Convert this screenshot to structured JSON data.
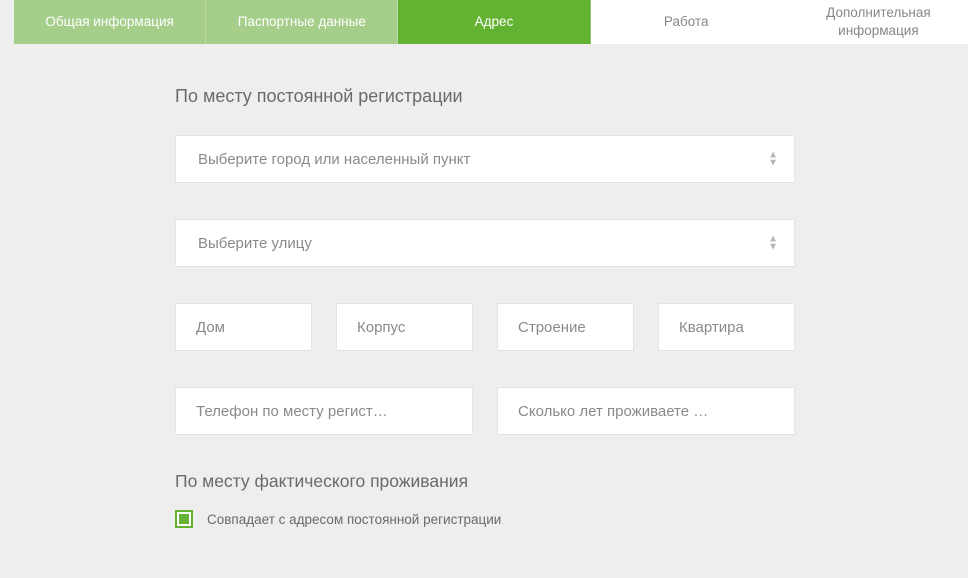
{
  "tabs": {
    "general": "Общая информация",
    "passport": "Паспортные данные",
    "address": "Адрес",
    "work": "Работа",
    "additional": "Дополнительная информация"
  },
  "section1_title": "По месту постоянной регистрации",
  "city_select": {
    "placeholder": "Выберите город или населенный пункт"
  },
  "street_select": {
    "placeholder": "Выберите улицу"
  },
  "house": {
    "placeholder": "Дом"
  },
  "building": {
    "placeholder": "Корпус"
  },
  "structure": {
    "placeholder": "Строение"
  },
  "flat": {
    "placeholder": "Квартира"
  },
  "phone": {
    "placeholder": "Телефон по месту регист…"
  },
  "years": {
    "placeholder": "Сколько лет проживаете …"
  },
  "section2_title": "По месту фактического проживания",
  "same_address_label": "Совпадает с адресом постоянной регистрации",
  "same_address_checked": true
}
